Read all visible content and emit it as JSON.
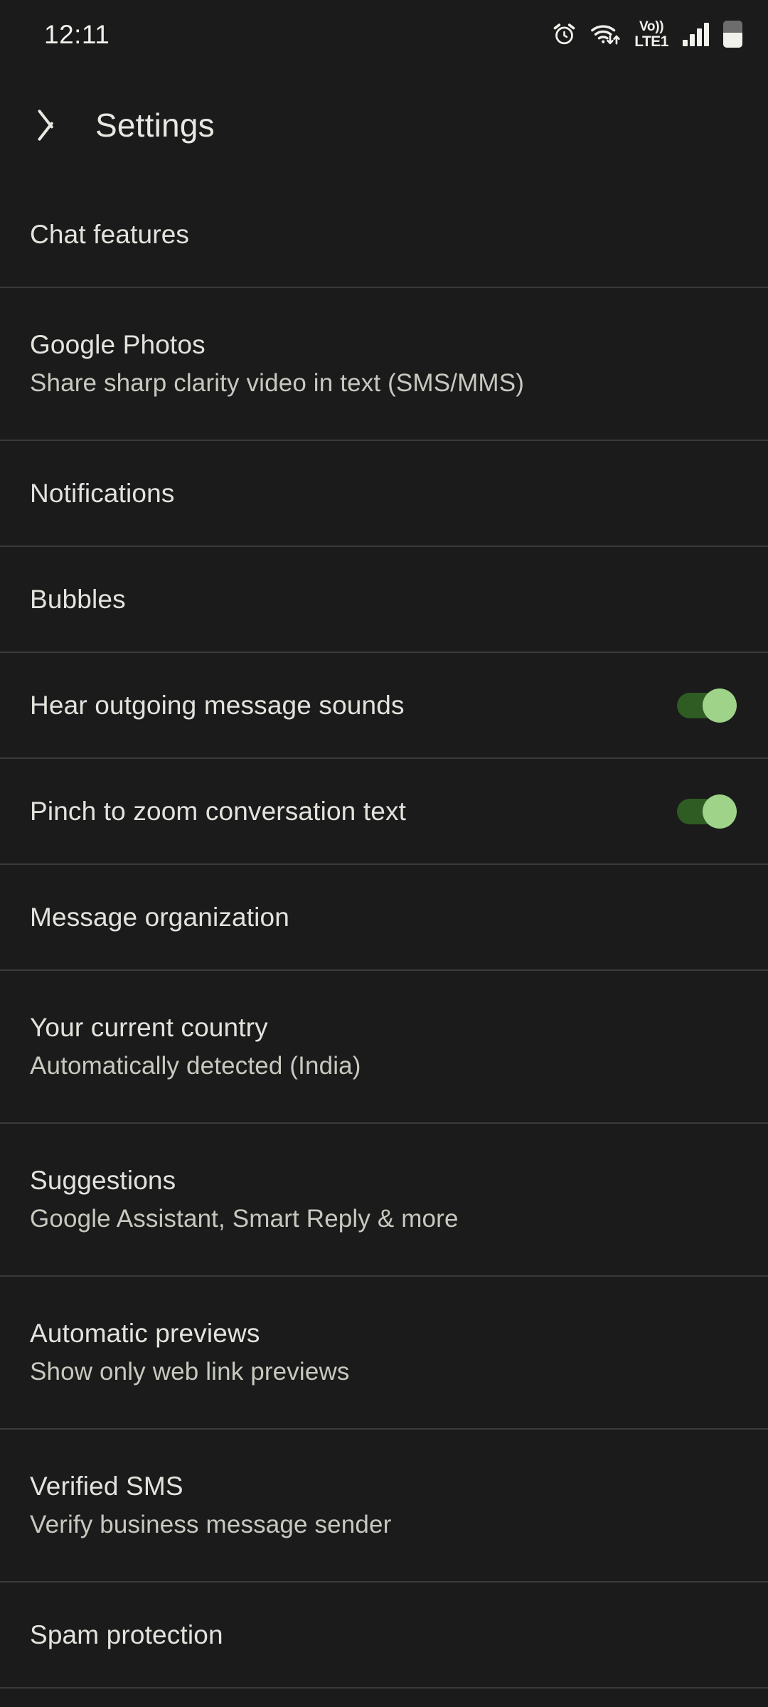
{
  "status_bar": {
    "time": "12:11",
    "icons": [
      {
        "name": "alarm-icon",
        "label": "alarm"
      },
      {
        "name": "wifi-icon",
        "label": "wifi"
      },
      {
        "name": "volte-icon",
        "line1": "Vo))",
        "line2": "LTE1"
      },
      {
        "name": "signal-icon",
        "label": "signal 4 bars"
      },
      {
        "name": "battery-icon",
        "label": "battery 55%"
      }
    ]
  },
  "app_bar": {
    "back_label": "Back",
    "title": "Settings"
  },
  "settings": {
    "rows": [
      {
        "title": "Chat features",
        "subtitle": "",
        "toggle": null
      },
      {
        "title": "Google Photos",
        "subtitle": "Share sharp clarity video in text (SMS/MMS)",
        "toggle": null
      },
      {
        "title": "Notifications",
        "subtitle": "",
        "toggle": null
      },
      {
        "title": "Bubbles",
        "subtitle": "",
        "toggle": null
      },
      {
        "title": "Hear outgoing message sounds",
        "subtitle": "",
        "toggle": "on"
      },
      {
        "title": "Pinch to zoom conversation text",
        "subtitle": "",
        "toggle": "on"
      },
      {
        "title": "Message organization",
        "subtitle": "",
        "toggle": null
      },
      {
        "title": "Your current country",
        "subtitle": "Automatically detected (India)",
        "toggle": null
      },
      {
        "title": "Suggestions",
        "subtitle": "Google Assistant, Smart Reply & more",
        "toggle": null
      },
      {
        "title": "Automatic previews",
        "subtitle": "Show only web link previews",
        "toggle": null
      },
      {
        "title": "Verified SMS",
        "subtitle": "Verify business message sender",
        "toggle": null
      },
      {
        "title": "Spam protection",
        "subtitle": "",
        "toggle": null
      }
    ]
  },
  "colors": {
    "background": "#1b1b1b",
    "title_text": "#e3e3de",
    "subtitle_text": "#c6c9bf",
    "divider": "#3a3a38",
    "toggle_track_on": "#2e5c22",
    "toggle_thumb_on": "#9fd389",
    "status_icon": "#f1f1ec"
  }
}
